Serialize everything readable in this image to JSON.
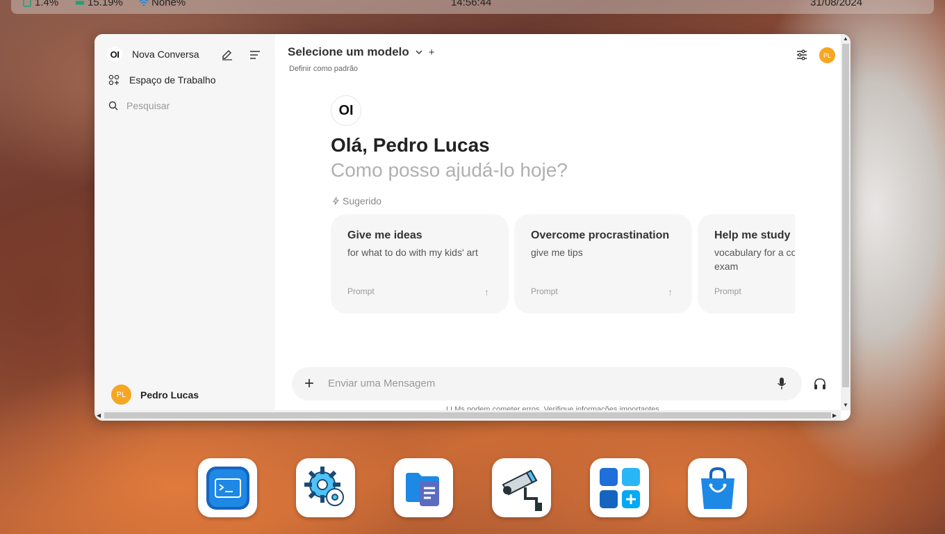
{
  "statusbar": {
    "cpu": "1.4%",
    "ram": "15.19%",
    "wifi": "None%",
    "time": "14:56:44",
    "date": "31/08/2024"
  },
  "sidebar": {
    "logo": "OI",
    "new_chat": "Nova Conversa",
    "workspace": "Espaço de Trabalho",
    "search_placeholder": "Pesquisar",
    "user_initials": "PL",
    "user_name": "Pedro Lucas"
  },
  "header": {
    "model_select": "Selecione um modelo",
    "set_default": "Definir como padrão",
    "user_initials": "PL"
  },
  "main": {
    "logo": "OI",
    "greeting": "Olá, Pedro Lucas",
    "subgreeting": "Como posso ajudá-lo hoje?",
    "suggested_label": "Sugerido",
    "cards": [
      {
        "title": "Give me ideas",
        "subtitle": "for what to do with my kids' art",
        "tag": "Prompt"
      },
      {
        "title": "Overcome procrastination",
        "subtitle": "give me tips",
        "tag": "Prompt"
      },
      {
        "title": "Help me study",
        "subtitle": "vocabulary for a college entrance exam",
        "tag": "Prompt"
      }
    ],
    "message_placeholder": "Enviar uma Mensagem",
    "disclaimer": "LLMs podem cometer erros. Verifique informações importantes."
  },
  "dock": [
    {
      "name": "terminal-app-icon"
    },
    {
      "name": "settings-app-icon"
    },
    {
      "name": "files-app-icon"
    },
    {
      "name": "camera-app-icon"
    },
    {
      "name": "apps-grid-icon"
    },
    {
      "name": "store-app-icon"
    }
  ],
  "colors": {
    "avatar": "#f5a623",
    "accent_blue": "#0a6cff"
  }
}
